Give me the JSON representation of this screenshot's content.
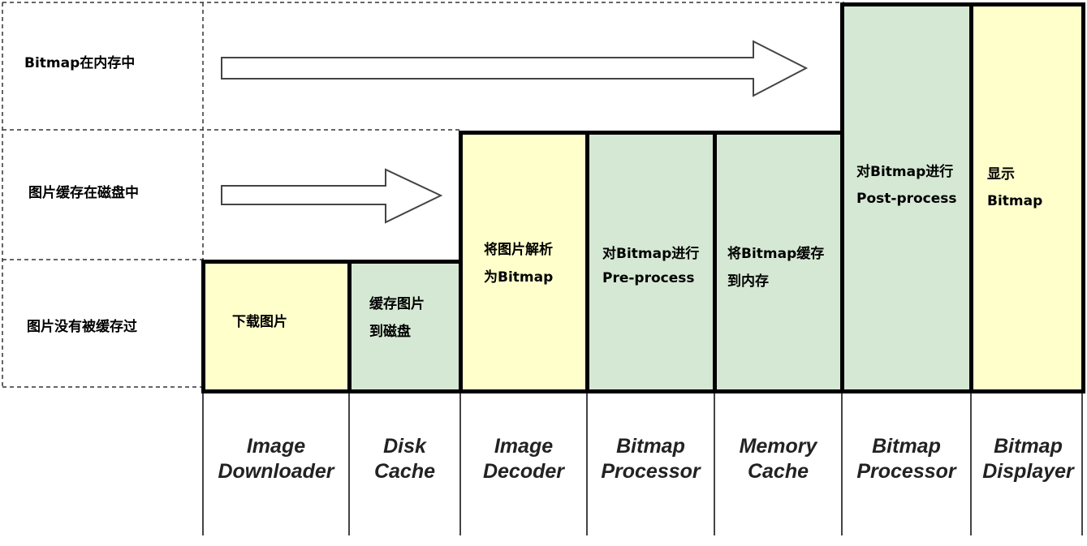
{
  "rows": [
    {
      "label": "Bitmap在内存中"
    },
    {
      "label": "图片缓存在磁盘中"
    },
    {
      "label": "图片没有被缓存过"
    }
  ],
  "steps": [
    {
      "lines": [
        "下载图片"
      ],
      "component": [
        "Image",
        "Downloader"
      ],
      "color": "#ffffcc"
    },
    {
      "lines": [
        "缓存图片",
        "到磁盘"
      ],
      "component": [
        "Disk",
        "Cache"
      ],
      "color": "#d5e8d4"
    },
    {
      "lines": [
        "将图片解析",
        "为Bitmap"
      ],
      "component": [
        "Image",
        "Decoder"
      ],
      "color": "#ffffcc"
    },
    {
      "lines": [
        "对Bitmap进行",
        "Pre-process"
      ],
      "component": [
        "Bitmap",
        "Processor"
      ],
      "color": "#d5e8d4"
    },
    {
      "lines": [
        "将Bitmap缓存",
        "到内存"
      ],
      "component": [
        "Memory",
        "Cache"
      ],
      "color": "#d5e8d4"
    },
    {
      "lines": [
        "对Bitmap进行",
        "Post-process"
      ],
      "component": [
        "Bitmap",
        "Processor"
      ],
      "color": "#d5e8d4"
    },
    {
      "lines": [
        "显示",
        "Bitmap"
      ],
      "component": [
        "Bitmap",
        "Displayer"
      ],
      "color": "#ffffcc"
    }
  ]
}
